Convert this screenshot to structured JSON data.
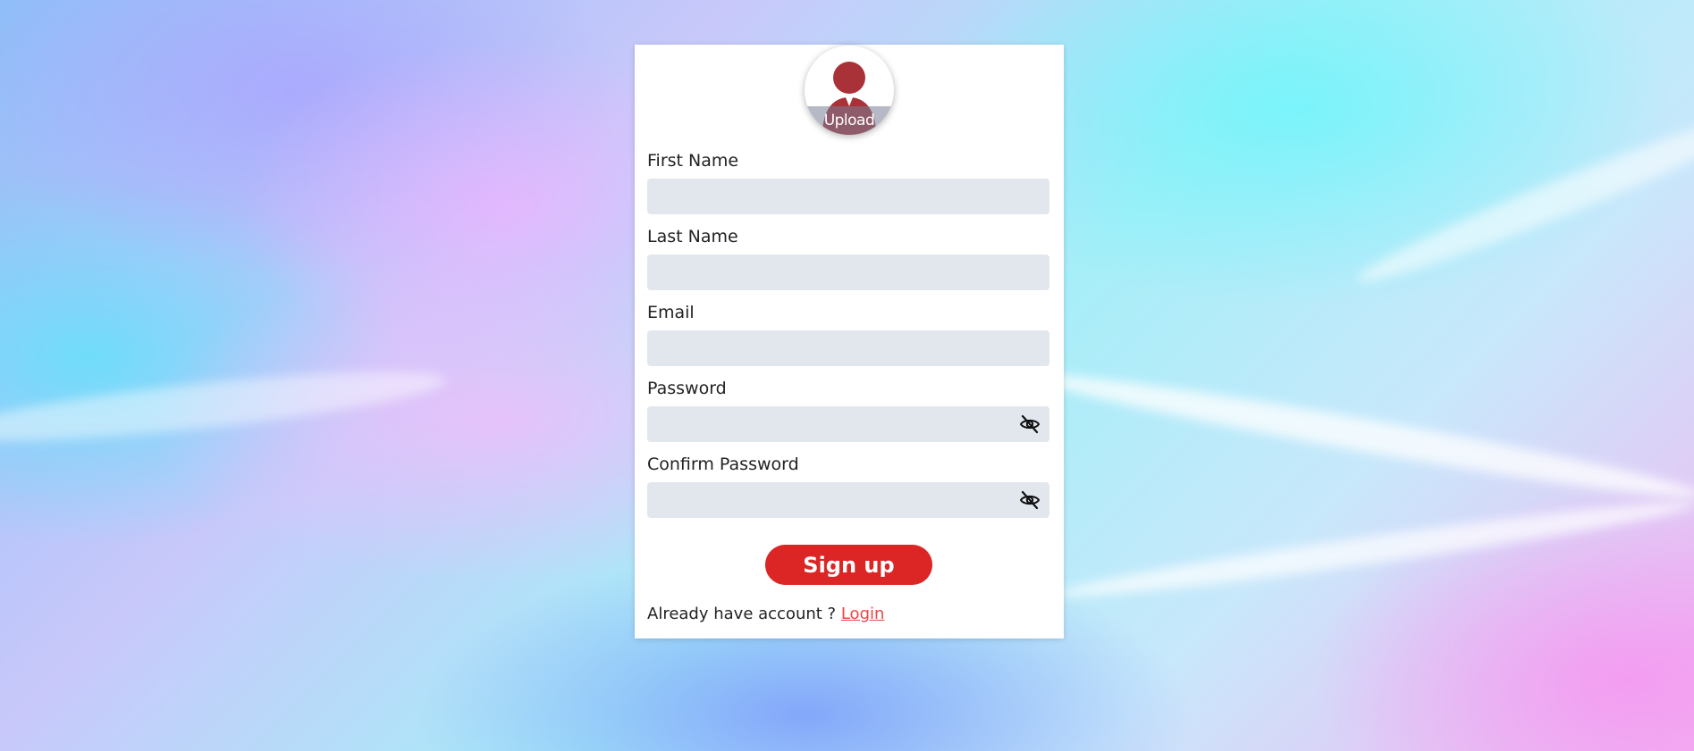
{
  "form": {
    "avatar": {
      "upload_label": "Upload",
      "icon": "user-avatar-icon",
      "icon_color": "#a83238"
    },
    "fields": [
      {
        "label": "First Name",
        "value": "",
        "type": "text"
      },
      {
        "label": "Last Name",
        "value": "",
        "type": "text"
      },
      {
        "label": "Email",
        "value": "",
        "type": "email"
      },
      {
        "label": "Password",
        "value": "",
        "type": "password",
        "toggle_icon": "eye-off-icon"
      },
      {
        "label": "Confirm Password",
        "value": "",
        "type": "password",
        "toggle_icon": "eye-off-icon"
      }
    ],
    "submit_label": "Sign up",
    "footer_text": "Already have account ?",
    "login_link": "Login"
  },
  "colors": {
    "accent": "#dc2626",
    "link": "#ef4444",
    "input_bg": "#e2e7ee"
  }
}
